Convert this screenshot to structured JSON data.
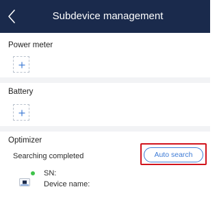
{
  "header": {
    "title": "Subdevice management"
  },
  "sections": {
    "power_meter": {
      "title": "Power meter",
      "add_symbol": "+"
    },
    "battery": {
      "title": "Battery",
      "add_symbol": "+"
    },
    "optimizer": {
      "title": "Optimizer",
      "status": "Searching completed",
      "auto_search_label": "Auto search",
      "device": {
        "sn_label": "SN:",
        "name_label": "Device name:",
        "status_color": "#3ec34a"
      }
    }
  },
  "colors": {
    "header_bg": "#1a2a4c",
    "accent": "#3d7bd6",
    "highlight": "#d1121b",
    "separator": "#f2f3f5"
  },
  "icons": {
    "back": "chevron-left-icon",
    "add": "plus-icon",
    "device": "optimizer-device-icon"
  }
}
